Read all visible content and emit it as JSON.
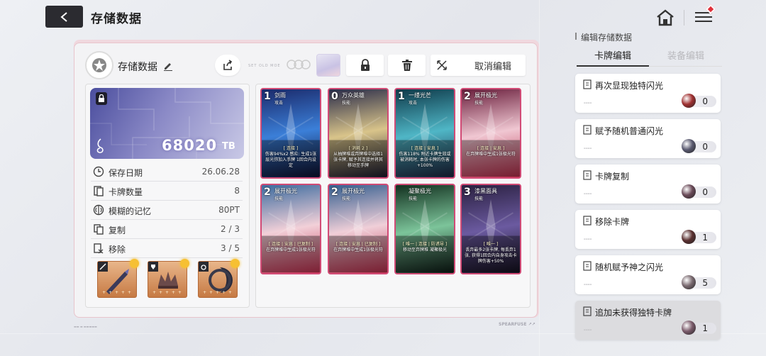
{
  "header": {
    "title": "存储数据"
  },
  "save": {
    "name": "存储数据",
    "tiny_text": "SET OLD MOE",
    "cancel_label": "取消编辑",
    "tb_value": "68020",
    "tb_unit": "TB"
  },
  "stats": [
    {
      "label": "保存日期",
      "value": "26.06.28",
      "icon": "clock-icon"
    },
    {
      "label": "卡牌数量",
      "value": "8",
      "icon": "cards-icon"
    },
    {
      "label": "模糊的记忆",
      "value": "80PT",
      "icon": "brain-icon"
    },
    {
      "label": "复制",
      "value": "2 / 3",
      "icon": "copy-icon"
    },
    {
      "label": "移除",
      "value": "3 / 5",
      "icon": "remove-icon"
    }
  ],
  "equipment": [
    {
      "name": "weapon",
      "stars": "+ + + + +"
    },
    {
      "name": "armor",
      "stars": "+ + + + +"
    },
    {
      "name": "ring",
      "stars": "+ + + + +"
    }
  ],
  "cards": [
    {
      "cost": "1",
      "name": "剑雨",
      "type": "攻击",
      "tag": "[ 连接 ]",
      "desc": "伤害94%x2 感应: 生成1张层光弥加入手牌 1回合内设定",
      "colors": [
        "#1b2a6b",
        "#3b7fd8",
        "#0d1030"
      ]
    },
    {
      "cost": "0",
      "name": "万众英雄",
      "type": "技能",
      "tag": "[ 消耗 2 ]",
      "desc": "从抽牌堆或弃牌堆中选择1张卡牌, 赋予其连接并将其移动至手牌",
      "colors": [
        "#2a2c4a",
        "#d9c48a",
        "#1a1a2e"
      ]
    },
    {
      "cost": "1",
      "name": "一缕光芒",
      "type": "攻击",
      "tag": "[ 连接 | 安息 ]",
      "desc": "伤害118% 附近卡牌生效或被消耗时, 本张卡牌的伤害+100%",
      "colors": [
        "#0f3a4a",
        "#4fb6c6",
        "#1c2440"
      ]
    },
    {
      "cost": "2",
      "name": "展开极光",
      "type": "技能",
      "tag": "[ 连接 | 安息 ]",
      "desc": "在弃牌堆中生成1张极光符",
      "colors": [
        "#6a1e3c",
        "#f0c7d2",
        "#b82c4a"
      ]
    },
    {
      "cost": "2",
      "name": "展开极光",
      "type": "技能",
      "tag": "[ 连接 | 安息 | 已复制 ]",
      "desc": "在弃牌堆中生成1张极光符",
      "colors": [
        "#3d6ca0",
        "#f2d0d8",
        "#c23050"
      ]
    },
    {
      "cost": "2",
      "name": "展开极光",
      "type": "技能",
      "tag": "[ 连接 | 安息 | 已复制 ]",
      "desc": "在弃牌堆中生成1张极光符",
      "colors": [
        "#355f90",
        "#f0cfd8",
        "#bc2e4c"
      ]
    },
    {
      "cost": "",
      "name": "凝聚极光",
      "type": "技能",
      "tag": "[ 唯一 | 连接 | 防诱导 ]",
      "desc": "移动至弃牌堆 凝聚极光",
      "colors": [
        "#12301f",
        "#7cc49a",
        "#0c1a14"
      ]
    },
    {
      "cost": "3",
      "name": "漆黑面具",
      "type": "技能",
      "tag": "[ 唯一 ]",
      "desc": "丢弃最多2张卡牌, 每丢弃1张, 获得1回合内自身攻击卡牌伤害+50%",
      "colors": [
        "#2a2040",
        "#6b5aa0",
        "#14101e"
      ]
    }
  ],
  "right_panel": {
    "title": "编辑存储数据",
    "tabs": [
      {
        "label": "卡牌编辑",
        "active": true
      },
      {
        "label": "装备编辑",
        "active": false
      }
    ],
    "effects": [
      {
        "label": "再次显现独特闪光",
        "count": "0",
        "gem_color": "#a03030"
      },
      {
        "label": "赋予随机普通闪光",
        "count": "0",
        "gem_color": "#5a5a70"
      },
      {
        "label": "卡牌复制",
        "count": "0",
        "gem_color": "#6a4a58"
      },
      {
        "label": "移除卡牌",
        "count": "1",
        "gem_color": "#5a3030"
      },
      {
        "label": "随机赋予神之闪光",
        "count": "5",
        "gem_color": "#7a6a70"
      },
      {
        "label": "追加未获得独特卡牌",
        "count": "1",
        "gem_color": "#7a5a6a"
      }
    ]
  },
  "footer": {
    "logo": "SPEARFUSE"
  }
}
